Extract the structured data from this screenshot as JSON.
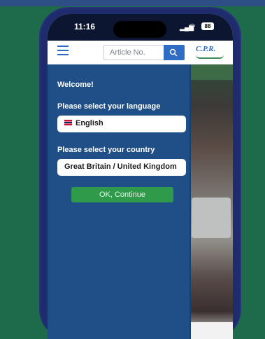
{
  "status_bar": {
    "time": "11:16",
    "battery": "88"
  },
  "header": {
    "search_placeholder": "Article No.",
    "logo_text": "C.P.R."
  },
  "welcome_panel": {
    "title": "Welcome!",
    "language_label": "Please select your language",
    "language_value": "English",
    "country_label": "Please select your country",
    "country_value": "Great Britain / United Kingdom",
    "ok_button": "OK, Continue"
  },
  "colors": {
    "background": "#1d6b4a",
    "panel": "#1f4f86",
    "button": "#2f9a4a",
    "accent": "#2f6cc4"
  }
}
